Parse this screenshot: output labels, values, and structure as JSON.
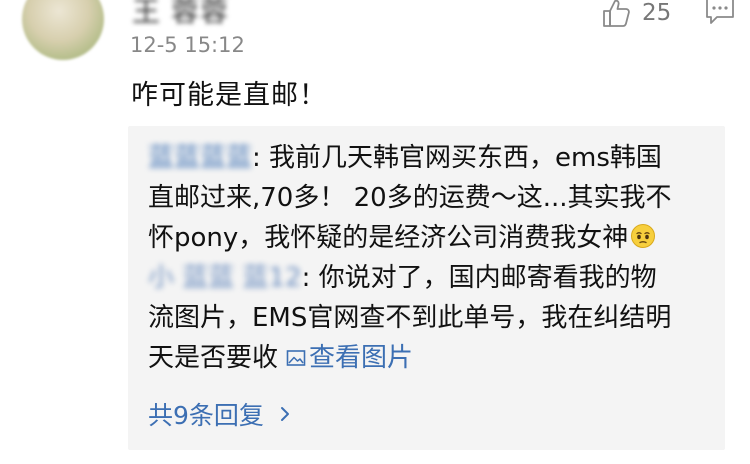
{
  "comment": {
    "username": "王 蓉蓉",
    "timestamp": "12-5 15:12",
    "like_count": "25",
    "text": "咋可能是直邮！"
  },
  "replies": [
    {
      "author": "蓝蓝蓝蓝",
      "lines": [
        "我前几天韩官网买东西，ems韩国",
        "直邮过来,70多！ 20多的运费～这...其实我不",
        "怀pony，我怀疑的是经济公司消费我女神"
      ],
      "emoji": "pensive-emoji"
    },
    {
      "author": "小 蓝蓝 蓝12",
      "lines": [
        "你说对了，国内邮寄看我的物",
        "流图片，EMS官网查不到此单号，我在纠结明",
        "天是否要收"
      ],
      "view_picture_label": "查看图片"
    }
  ],
  "more_replies_label": "共9条回复",
  "icons": {
    "like": "thumbs-up-icon",
    "reply": "comment-bubble-icon",
    "picture": "picture-icon",
    "more": "chevron-right-icon"
  },
  "colors": {
    "link": "#3c6fb3",
    "reply_bg": "#f4f4f4",
    "meta": "#888888"
  }
}
